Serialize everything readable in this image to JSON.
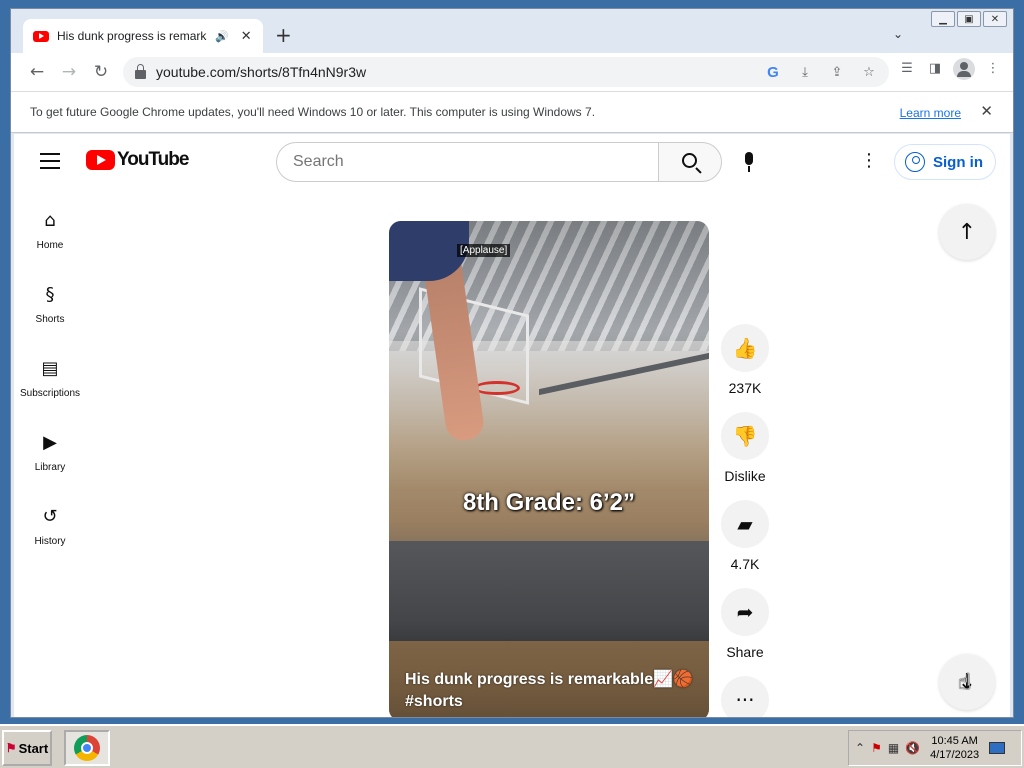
{
  "browser": {
    "tab_title": "His dunk progress is remarkable",
    "tab_audio_icon": "speaker-icon",
    "new_tab_label": "+",
    "url": "youtube.com/shorts/8Tfn4nN9r3w",
    "window_buttons": [
      "minimize",
      "maximize",
      "close"
    ]
  },
  "infobar": {
    "message": "To get future Google Chrome updates, you'll need Windows 10 or later. This computer is using Windows 7.",
    "link": "Learn more"
  },
  "youtube": {
    "logo_text": "YouTube",
    "search_placeholder": "Search",
    "signin_label": "Sign in",
    "sidebar": [
      {
        "label": "Home",
        "icon": "home-icon"
      },
      {
        "label": "Shorts",
        "icon": "shorts-icon"
      },
      {
        "label": "Subscriptions",
        "icon": "subscriptions-icon"
      },
      {
        "label": "Library",
        "icon": "library-icon"
      },
      {
        "label": "History",
        "icon": "history-icon"
      }
    ],
    "short": {
      "caption_tag": "[Applause]",
      "overlay_text": "8th Grade: 6’2”",
      "title": "His dunk progress is remarkable📈🏀 #shorts"
    },
    "actions": {
      "likes": "237K",
      "dislike": "Dislike",
      "comments": "4.7K",
      "share": "Share"
    }
  },
  "taskbar": {
    "start_label": "Start",
    "time": "10:45 AM",
    "date": "4/17/2023"
  },
  "colors": {
    "youtube_red": "#ff0000",
    "signin_blue": "#065fd4",
    "link_blue": "#1a73e8"
  }
}
